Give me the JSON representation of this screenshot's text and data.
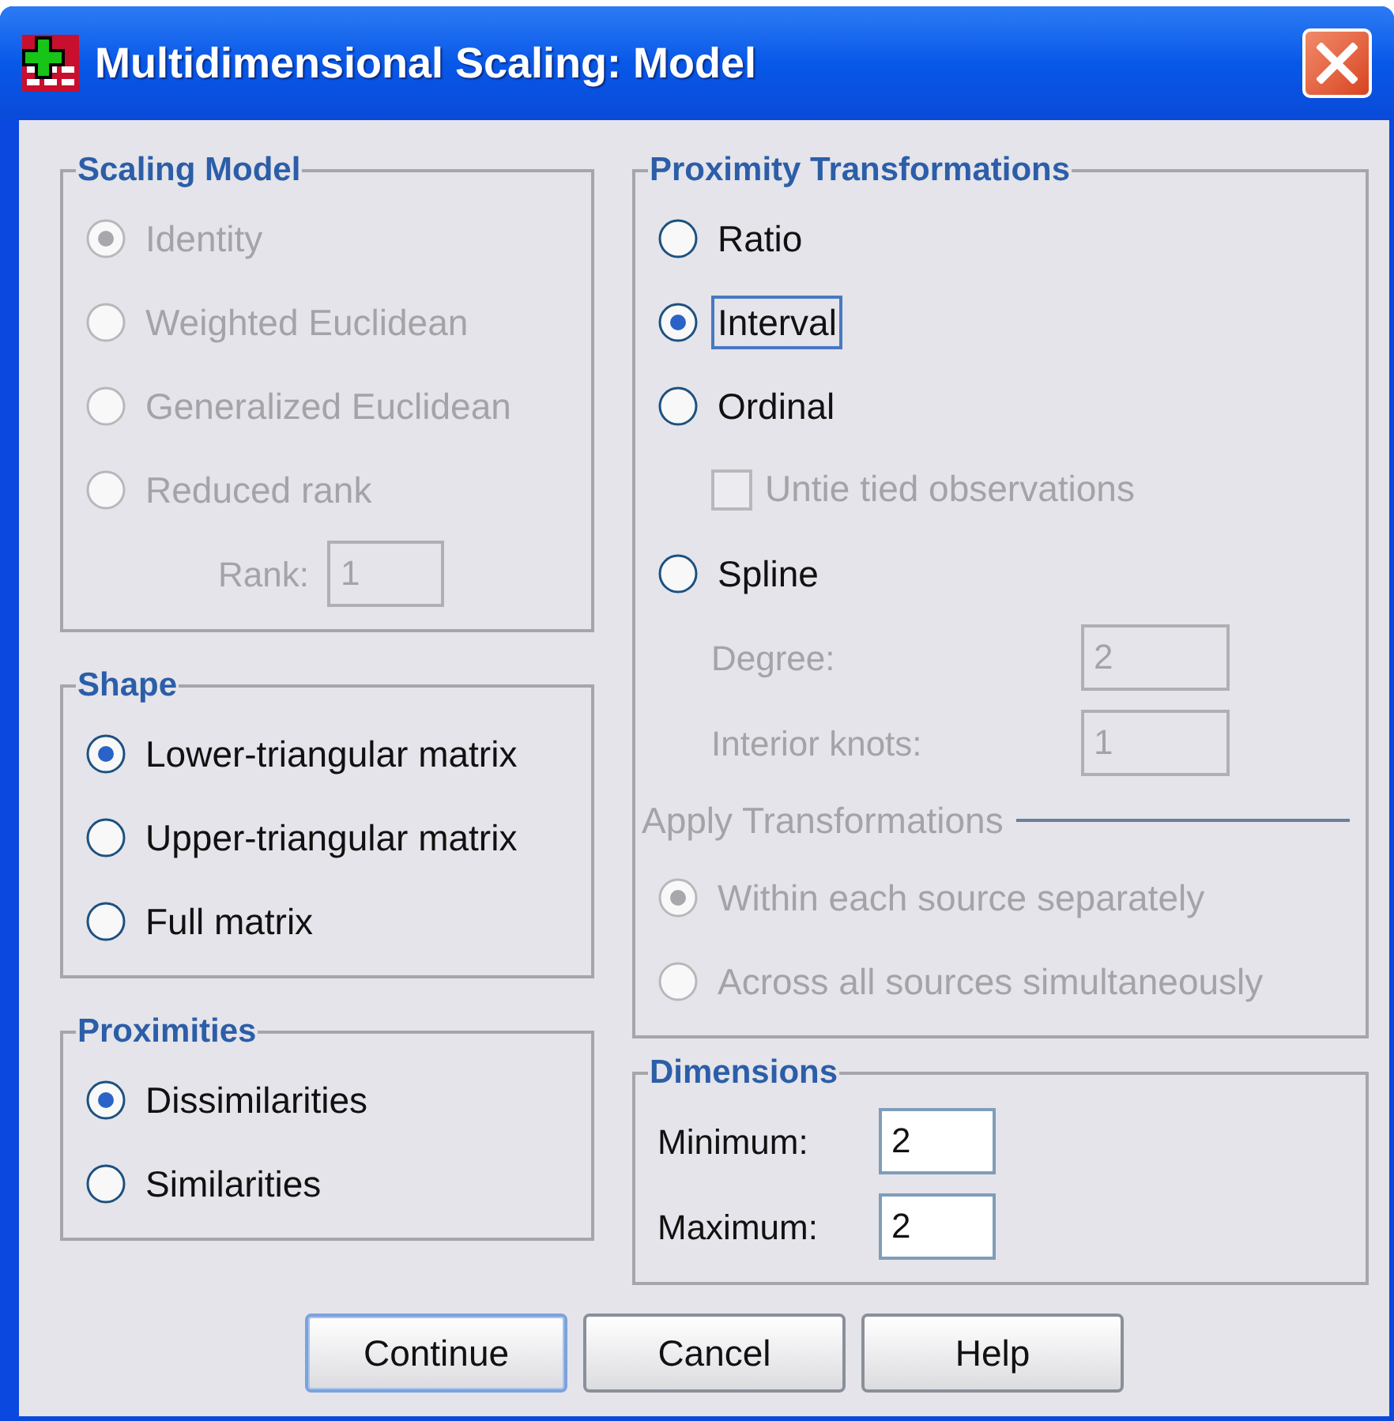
{
  "window": {
    "title": "Multidimensional Scaling: Model"
  },
  "left_column": [
    {
      "title": "Scaling Model",
      "items": [
        {
          "kind": "radio",
          "label": "Identity",
          "selected": true,
          "disabled": true,
          "focused": false
        },
        {
          "kind": "radio",
          "label": "Weighted Euclidean",
          "selected": false,
          "disabled": true,
          "focused": false
        },
        {
          "kind": "radio",
          "label": "Generalized Euclidean",
          "selected": false,
          "disabled": true,
          "focused": false
        },
        {
          "kind": "radio",
          "label": "Reduced rank",
          "selected": false,
          "disabled": true,
          "focused": false,
          "children": [
            {
              "kind": "field",
              "label": "Rank:",
              "value": "1",
              "disabled": true
            }
          ]
        }
      ]
    },
    {
      "title": "Shape",
      "items": [
        {
          "kind": "radio",
          "label": "Lower-triangular matrix",
          "selected": true,
          "disabled": false,
          "focused": false
        },
        {
          "kind": "radio",
          "label": "Upper-triangular matrix",
          "selected": false,
          "disabled": false,
          "focused": false
        },
        {
          "kind": "radio",
          "label": "Full matrix",
          "selected": false,
          "disabled": false,
          "focused": false
        }
      ]
    },
    {
      "title": "Proximities",
      "items": [
        {
          "kind": "radio",
          "label": "Dissimilarities",
          "selected": true,
          "disabled": false,
          "focused": false
        },
        {
          "kind": "radio",
          "label": "Similarities",
          "selected": false,
          "disabled": false,
          "focused": false
        }
      ]
    }
  ],
  "right_column": [
    {
      "title": "Proximity Transformations",
      "items": [
        {
          "kind": "radio",
          "label": "Ratio",
          "selected": false,
          "disabled": false,
          "focused": false
        },
        {
          "kind": "radio",
          "label": "Interval",
          "selected": true,
          "disabled": false,
          "focused": true
        },
        {
          "kind": "radio",
          "label": "Ordinal",
          "selected": false,
          "disabled": false,
          "focused": false,
          "children": [
            {
              "kind": "checkbox",
              "label": "Untie tied observations",
              "checked": false,
              "disabled": true
            }
          ]
        },
        {
          "kind": "radio",
          "label": "Spline",
          "selected": false,
          "disabled": false,
          "focused": false,
          "children": [
            {
              "kind": "field",
              "label": "Degree:",
              "value": "2",
              "disabled": true
            },
            {
              "kind": "field",
              "label": "Interior knots:",
              "value": "1",
              "disabled": true
            }
          ]
        },
        {
          "kind": "subheading",
          "label": "Apply Transformations",
          "disabled": true
        },
        {
          "kind": "radio",
          "label": "Within each source separately",
          "selected": true,
          "disabled": true,
          "focused": false
        },
        {
          "kind": "radio",
          "label": "Across all sources simultaneously",
          "selected": false,
          "disabled": true,
          "focused": false
        }
      ]
    },
    {
      "title": "Dimensions",
      "items": [
        {
          "kind": "field",
          "label": "Minimum:",
          "value": "2",
          "disabled": false
        },
        {
          "kind": "field",
          "label": "Maximum:",
          "value": "2",
          "disabled": false
        }
      ]
    }
  ],
  "buttons": [
    {
      "label": "Continue",
      "default": true
    },
    {
      "label": "Cancel",
      "default": false
    },
    {
      "label": "Help",
      "default": false
    }
  ]
}
